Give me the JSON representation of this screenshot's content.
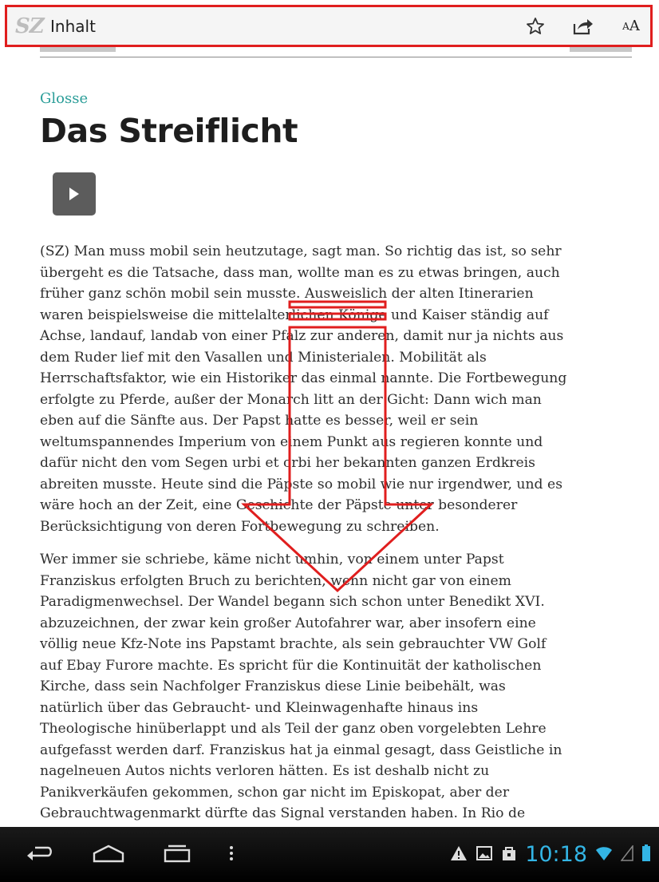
{
  "topbar": {
    "logo": "SZ",
    "title": "Inhalt",
    "icons": [
      "star-icon",
      "share-icon",
      "text-size-icon"
    ],
    "text_size_small": "A",
    "text_size_large": "A"
  },
  "article": {
    "kicker": "Glosse",
    "headline": "Das Streiflicht",
    "paragraphs": [
      "(SZ) Man muss mobil sein heutzutage, sagt man. So richtig das ist, so sehr übergeht es die Tatsache, dass man, wollte man es zu etwas bringen, auch früher ganz schön mobil sein musste. Ausweislich der alten Itinerarien waren beispielsweise die mittelalterlichen Könige und Kaiser ständig auf Achse, landauf, landab von einer Pfalz zur anderen, damit nur ja nichts aus dem Ruder lief mit den Vasallen und Ministerialen. Mobilität als Herrschaftsfaktor, wie ein Historiker das einmal nannte. Die Fortbewegung erfolgte zu Pferde, außer der Monarch litt an der Gicht: Dann wich man eben auf die Sänfte aus. Der Papst hatte es besser, weil er sein weltumspannendes Imperium von einem Punkt aus regieren konnte und dafür nicht den vom Segen urbi et orbi her bekannten ganzen Erdkreis abreiten musste. Heute sind die Päpste so mobil wie nur irgendwer, und es wäre hoch an der Zeit, eine Geschichte der Päpste unter besonderer Berücksichtigung von deren Fortbewegung zu schreiben.",
      "Wer immer sie schriebe, käme nicht umhin, von einem unter Papst Franziskus erfolgten Bruch zu berichten, wenn nicht gar von einem Paradigmenwechsel. Der Wandel begann sich schon unter Benedikt XVI. abzuzeichnen, der zwar kein großer Autofahrer war, aber insofern eine völlig neue Kfz-Note ins Papstamt brachte, als sein gebrauchter VW Golf auf Ebay Furore machte. Es spricht für die Kontinuität der katholischen Kirche, dass sein Nachfolger Franziskus diese Linie beibehält, was natürlich über das Gebraucht- und Kleinwagenhafte hinaus ins Theologische hinüberlappt und als Teil der ganz oben vorgelebten Lehre aufgefasst werden darf. Franziskus hat ja einmal gesagt, dass Geistliche in nagelneuen Autos nichts verloren hätten. Es ist deshalb nicht zu Panikverkäufen gekommen, schon gar nicht im Episkopat, aber der Gebrauchtwagenmarkt dürfte das Signal verstanden haben. In Rio de Janeiro hat Franziskus...",
      ""
    ]
  },
  "system_bar": {
    "clock": "10:18",
    "nav_icons": [
      "back-icon",
      "home-icon",
      "recents-icon",
      "menu-icon"
    ],
    "status_icons": [
      "warning-icon",
      "image-icon",
      "shopping-bag-icon",
      "wifi-icon",
      "signal-icon",
      "battery-icon"
    ]
  },
  "colors": {
    "accent": "#2a9d98",
    "highlight": "#e01e1e",
    "clock": "#33b5e5"
  }
}
